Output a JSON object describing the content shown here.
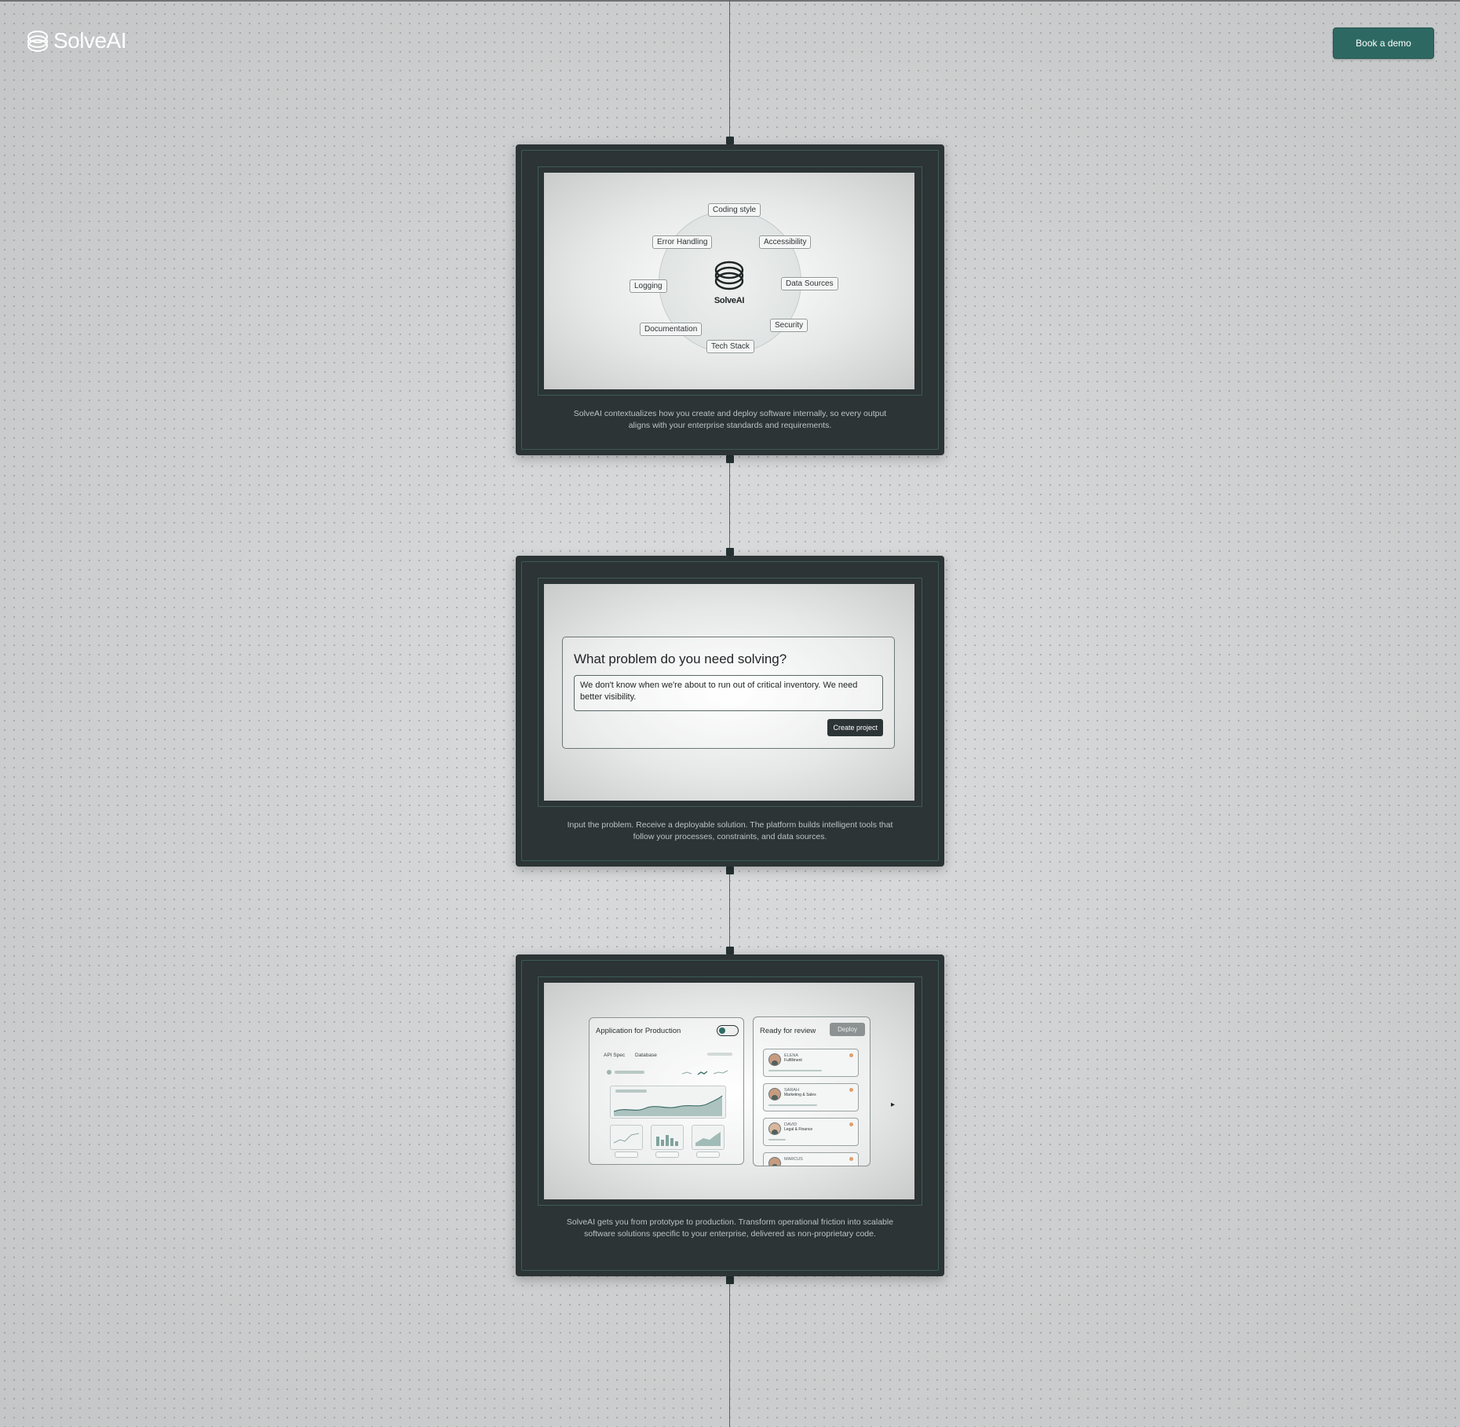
{
  "header": {
    "brand": "SolveAI",
    "cta_label": "Book a demo"
  },
  "cards": [
    {
      "diagram": {
        "center_label": "SolveAI",
        "tags": [
          "Coding style",
          "Accessibility",
          "Data Sources",
          "Security",
          "Tech Stack",
          "Documentation",
          "Logging",
          "Error Handling"
        ]
      },
      "caption": "SolveAI contextualizes how you create and deploy software internally, so every output aligns with your enterprise standards and requirements."
    },
    {
      "problem": {
        "title": "What problem do you need solving?",
        "input_value": "We don't know when we're about to run out of critical inventory. We need better visibility.",
        "button_label": "Create project"
      },
      "caption": "Input the problem. Receive a deployable solution. The platform builds intelligent tools that follow your processes, constraints, and data sources."
    },
    {
      "app": {
        "title": "Application for Production",
        "tabs": [
          "API Spec",
          "Database"
        ],
        "toggle_on": true
      },
      "review": {
        "title": "Ready for review",
        "deploy_label": "Deploy",
        "people": [
          {
            "name": "ELENA",
            "role": "Fulfillment"
          },
          {
            "name": "SARAH",
            "role": "Marketing & Sales"
          },
          {
            "name": "DAVID",
            "role": "Legal & Finance"
          },
          {
            "name": "MARCUS",
            "role": ""
          }
        ]
      },
      "caption": "SolveAI gets you from prototype to production. Transform operational friction into scalable software solutions specific to your enterprise, delivered as non-proprietary code."
    }
  ],
  "colors": {
    "accent": "#2d6962",
    "card_bg": "#2c3435",
    "page_bg": "#d3d4d5"
  }
}
